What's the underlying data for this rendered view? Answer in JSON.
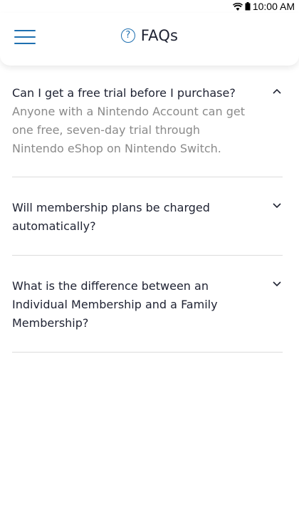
{
  "status_bar": {
    "time": "10:00 AM",
    "icons": [
      "wifi-icon",
      "battery-icon"
    ]
  },
  "header": {
    "title": "FAQs",
    "help_icon_glyph": "?",
    "menu_icon": "hamburger-menu-icon",
    "accent_color": "#1e6fb0"
  },
  "faqs": [
    {
      "question": "Can I get a free trial before I purchase?",
      "answer": "Anyone with a Nintendo Account can get one free, seven-day trial through Nintendo eShop on Nintendo Switch.",
      "expanded": true
    },
    {
      "question": "Will membership plans be charged automatically?",
      "answer": "",
      "expanded": false
    },
    {
      "question": "What is the difference between an Individual Membership and a Family Membership?",
      "answer": "",
      "expanded": false
    }
  ]
}
